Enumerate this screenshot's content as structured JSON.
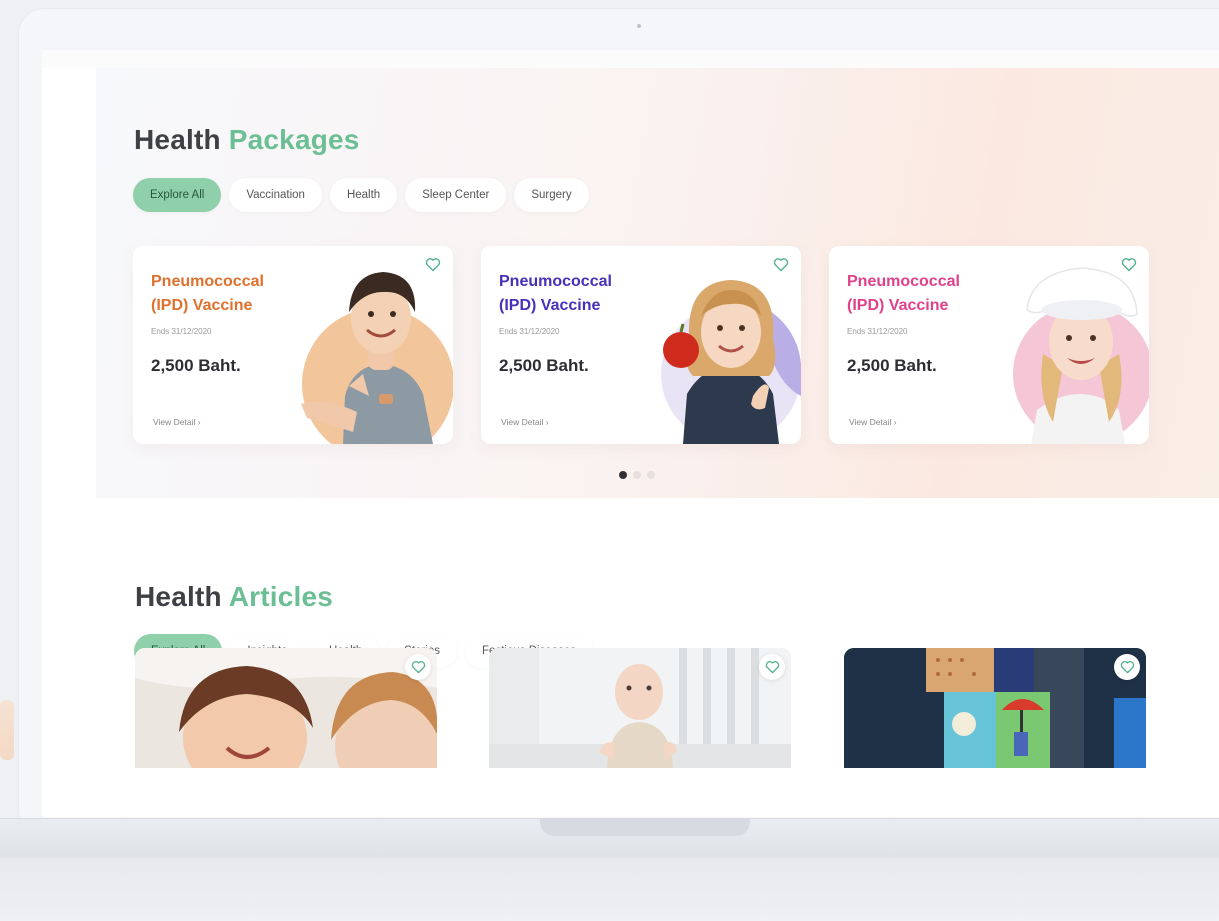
{
  "packages": {
    "title_main": "Health",
    "title_accent": "Packages",
    "filters": [
      "Explore All",
      "Vaccination",
      "Health",
      "Sleep Center",
      "Surgery"
    ],
    "cards": [
      {
        "title": "Pneumococcal (IPD) Vaccine",
        "ends": "Ends 31/12/2020",
        "price": "2,500 Baht.",
        "link": "View Detail",
        "title_color": "#e0702c",
        "image_icon": "child-thumbs-up-icon"
      },
      {
        "title": "Pneumococcal (IPD) Vaccine",
        "ends": "Ends 31/12/2020",
        "price": "2,500 Baht.",
        "link": "View Detail",
        "title_color": "#4a2fb8",
        "image_icon": "child-apple-icon"
      },
      {
        "title": "Pneumococcal (IPD) Vaccine",
        "ends": "Ends 31/12/2020",
        "price": "2,500 Baht.",
        "link": "View Detail",
        "title_color": "#e0418a",
        "image_icon": "girl-hat-icon"
      }
    ],
    "carousel": {
      "pages": 3,
      "active": 1
    }
  },
  "articles": {
    "title_main": "Health",
    "title_accent": "Articles",
    "filters": [
      "Explore All",
      "Insights",
      "Health",
      "Stories",
      "Fectious Diseases"
    ],
    "cards": [
      {
        "image_icon": "children-smiling-icon"
      },
      {
        "image_icon": "baby-toy-icon"
      },
      {
        "image_icon": "toy-blocks-icon"
      }
    ]
  },
  "colors": {
    "accent": "#6cbf94",
    "chip_active": "#8fd0aa",
    "heart": "#56b38c"
  }
}
